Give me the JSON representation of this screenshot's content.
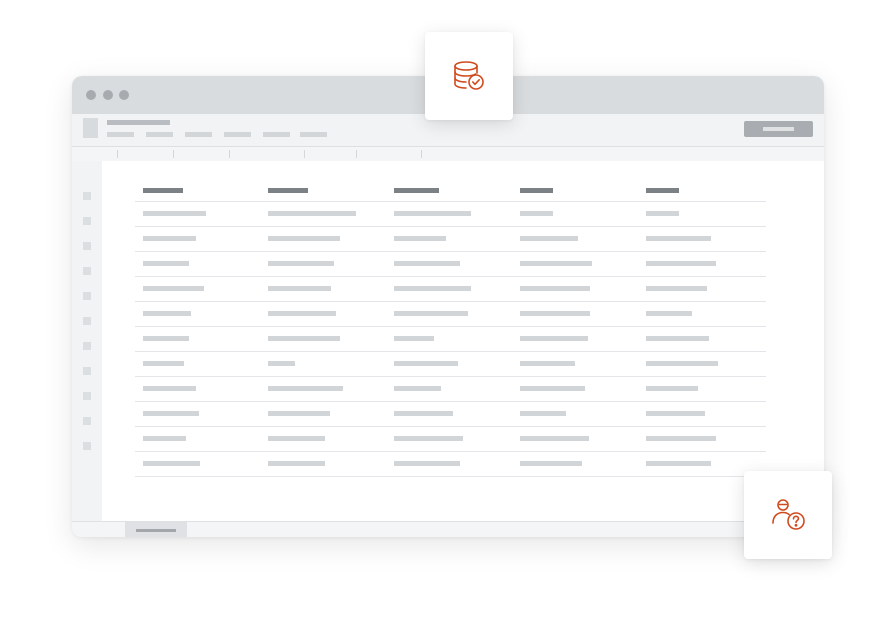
{
  "colors": {
    "accent": "#d04a1e",
    "titlebar": "#d9dcde",
    "placeholder": "#d2d5d8",
    "header_placeholder": "#7c8186"
  },
  "badges": {
    "top": {
      "icon": "database-check-icon"
    },
    "bottom": {
      "icon": "user-question-icon"
    }
  },
  "table": {
    "columns": 5,
    "rows": 11
  }
}
